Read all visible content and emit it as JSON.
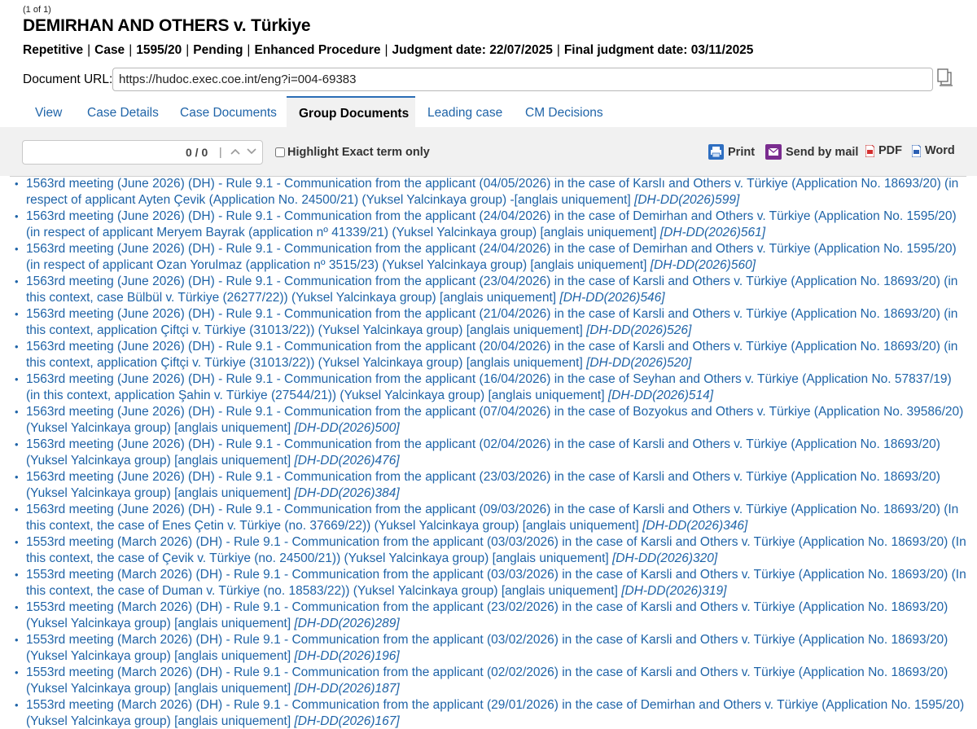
{
  "header": {
    "counter": "(1 of 1)",
    "title": "DEMIRHAN AND OTHERS v. Türkiye",
    "meta": [
      "Repetitive",
      "Case",
      "1595/20",
      "Pending",
      "Enhanced Procedure",
      "Judgment date: 22/07/2025",
      "Final judgment date: 03/11/2025"
    ],
    "separator": "|"
  },
  "url": {
    "label": "Document URL:",
    "value": "https://hudoc.exec.coe.int/eng?i=004-69383",
    "icon": "copy-icon"
  },
  "tabs": [
    {
      "label": "View"
    },
    {
      "label": "Case Details"
    },
    {
      "label": "Case Documents"
    },
    {
      "label": "Group Documents",
      "active": true
    },
    {
      "label": "Leading case"
    },
    {
      "label": "CM Decisions"
    }
  ],
  "toolbar": {
    "search_count": "0 / 0",
    "search_sep": "|",
    "highlight_label": "Highlight Exact term only",
    "print_label": "Print",
    "mail_label": "Send by mail",
    "pdf_label": "PDF",
    "word_label": "Word"
  },
  "colors": {
    "link": "#1f64a8",
    "tab_accent": "#2a6db5",
    "toolbar_bg": "#f1f1f1"
  },
  "documents": [
    {
      "text": "1563rd meeting (June 2026) (DH) - Rule 9.1 - Communication from the applicant (04/05/2026) in the case of Karslı and Others v. Türkiye (Application No. 18693/20) (in respect of applicant Ayten Çevik (Application No. 24500/21) (Yuksel Yalcinkaya group) -[anglais uniquement]",
      "ref": "[DH-DD(2026)599]"
    },
    {
      "text": "1563rd meeting (June 2026) (DH) - Rule 9.1 - Communication from the applicant (24/04/2026) in the case of Demirhan and Others v. Türkiye (Application No. 1595/20) (in respect of applicant Meryem Bayrak (application nº 41339/21) (Yuksel Yalcinkaya group) [anglais uniquement]",
      "ref": "[DH-DD(2026)561]"
    },
    {
      "text": "1563rd meeting (June 2026) (DH) - Rule 9.1 - Communication from the applicant (24/04/2026) in the case of Demirhan and Others v. Türkiye (Application No. 1595/20) (in respect of applicant Ozan Yorulmaz (application nº 3515/23) (Yuksel Yalcinkaya group) [anglais uniquement]",
      "ref": "[DH-DD(2026)560]"
    },
    {
      "text": "1563rd meeting (June 2026) (DH) - Rule 9.1 - Communication from the applicant (23/04/2026) in the case of Karsli and Others v. Türkiye (Application No. 18693/20) (in this context, case Bülbül v. Türkiye (26277/22)) (Yuksel Yalcinkaya group) [anglais uniquement]",
      "ref": "[DH-DD(2026)546]"
    },
    {
      "text": "1563rd meeting (June 2026) (DH) - Rule 9.1 - Communication from the applicant (21/04/2026) in the case of Karsli and Others v. Türkiye (Application No. 18693/20) (in this context, application Çiftçi v. Türkiye (31013/22)) (Yuksel Yalcinkaya group) [anglais uniquement]",
      "ref": "[DH-DD(2026)526]"
    },
    {
      "text": "1563rd meeting (June 2026) (DH) - Rule 9.1 - Communication from the applicant (20/04/2026) in the case of Karsli and Others v. Türkiye (Application No. 18693/20) (in this context, application Çiftçi v. Türkiye (31013/22)) (Yuksel Yalcinkaya group) [anglais uniquement]",
      "ref": "[DH-DD(2026)520]"
    },
    {
      "text": "1563rd meeting (June 2026) (DH) - Rule 9.1 - Communication from the applicant (16/04/2026) in the case of Seyhan and Others v. Türkiye (Application No. 57837/19) (in this context, application Şahin v. Türkiye (27544/21)) (Yuksel Yalcinkaya group) [anglais uniquement]",
      "ref": "[DH-DD(2026)514]"
    },
    {
      "text": "1563rd meeting (June 2026) (DH) - Rule 9.1 - Communication from the applicant (07/04/2026) in the case of Bozyokus and Others v. Türkiye (Application No. 39586/20) (Yuksel Yalcinkaya group) [anglais uniquement]",
      "ref": "[DH-DD(2026)500]"
    },
    {
      "text": "1563rd meeting (June 2026) (DH) - Rule 9.1 - Communication from the applicant (02/04/2026) in the case of Karsli and Others v. Türkiye (Application No. 18693/20) (Yuksel Yalcinkaya group) [anglais uniquement]",
      "ref": "[DH-DD(2026)476]"
    },
    {
      "text": "1563rd meeting (June 2026) (DH) - Rule 9.1 - Communication from the applicant (23/03/2026) in the case of Karsli and Others v. Türkiye (Application No. 18693/20) (Yuksel Yalcinkaya group) [anglais uniquement]",
      "ref": "[DH-DD(2026)384]"
    },
    {
      "text": "1563rd meeting (June 2026) (DH) - Rule 9.1 - Communication from the applicant (09/03/2026) in the case of Karsli and Others v. Türkiye (Application No. 18693/20) (In this context, the case of Enes Çetin v. Türkiye (no. 37669/22)) (Yuksel Yalcinkaya group) [anglais uniquement]",
      "ref": "[DH-DD(2026)346]"
    },
    {
      "text": "1553rd meeting (March 2026) (DH) - Rule 9.1 - Communication from the applicant (03/03/2026) in the case of Karsli and Others v. Türkiye (Application No. 18693/20) (In this context, the case of Çevik v. Türkiye (no. 24500/21)) (Yuksel Yalcinkaya group) [anglais uniquement]",
      "ref": "[DH-DD(2026)320]"
    },
    {
      "text": "1553rd meeting (March 2026) (DH) - Rule 9.1 - Communication from the applicant (03/03/2026) in the case of Karsli and Others v. Türkiye (Application No. 18693/20) (In this context, the case of Duman v. Türkiye (no. 18583/22)) (Yuksel Yalcinkaya group) [anglais uniquement]",
      "ref": "[DH-DD(2026)319]"
    },
    {
      "text": "1553rd meeting (March 2026) (DH) - Rule 9.1 - Communication from the applicant (23/02/2026) in the case of Karsli and Others v. Türkiye (Application No. 18693/20) (Yuksel Yalcinkaya group) [anglais uniquement]",
      "ref": "[DH-DD(2026)289]"
    },
    {
      "text": "1553rd meeting (March 2026) (DH) - Rule 9.1 - Communication from the applicant (03/02/2026) in the case of Karsli and Others v. Türkiye (Application No. 18693/20) (Yuksel Yalcinkaya group) [anglais uniquement]",
      "ref": "[DH-DD(2026)196]"
    },
    {
      "text": "1553rd meeting (March 2026) (DH) - Rule 9.1 - Communication from the applicant (02/02/2026) in the case of Karsli and Others v. Türkiye (Application No. 18693/20) (Yuksel Yalcinkaya group) [anglais uniquement]",
      "ref": "[DH-DD(2026)187]"
    },
    {
      "text": "1553rd meeting (March 2026) (DH) - Rule 9.1 - Communication from the applicant (29/01/2026) in the case of Demirhan and Others v. Türkiye (Application No. 1595/20) (Yuksel Yalcinkaya group) [anglais uniquement]",
      "ref": "[DH-DD(2026)167]"
    }
  ]
}
